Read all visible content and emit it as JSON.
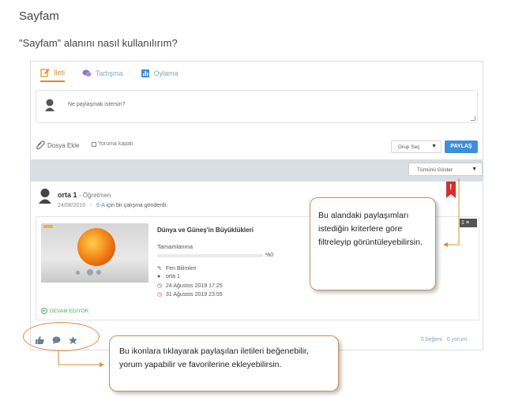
{
  "page": {
    "heading": "Sayfam",
    "question": "\"Sayfam\" alanını nasıl kullanılırım?"
  },
  "composer": {
    "tabs": [
      {
        "label": "İleti",
        "icon": "edit-icon"
      },
      {
        "label": "Tartışma",
        "icon": "chat-icon"
      },
      {
        "label": "Oylama",
        "icon": "poll-icon"
      }
    ],
    "placeholder": "Ne paylaşmak istersin?",
    "attach_label": "Dosya Ekle",
    "comment_off_label": "Yoruma kapalı",
    "group_select": "Grup Seç",
    "share_label": "PAYLAŞ"
  },
  "filter": {
    "selected": "Tümünü Göster"
  },
  "post": {
    "author": "orta 1",
    "role": "- Öğretmen",
    "date": "24/08/2019",
    "class": "6-A",
    "action_text": "için bir çalışma gönderdi.",
    "card": {
      "title": "Dünya ve Güneş'in Büyüklükleri",
      "progress_label": "Tamamlanma",
      "progress_text": "%0",
      "progress_value": 0,
      "subject": "Fen Bilimleri",
      "owner": "orta 1",
      "start": "24 Ağustos 2019 17:25",
      "end": "31 Ağustos 2019 23:55",
      "status": "DEVAM EDİYOR",
      "counter": "1"
    },
    "likes": "0 beğeni",
    "comments": "0 yorum"
  },
  "callouts": {
    "right": "Bu alandaki paylaşımları istediğin kriterlere göre filtreleyip görüntüleyebilirsin.",
    "bottom": "Bu ikonlara tıklayarak paylaşılan iletileri beğenebilir, yorum yapabilir ve favorilerine ekleyebilirsin."
  },
  "colors": {
    "accent": "#e38b23",
    "primary": "#3e8edb",
    "callout_border": "#c69060",
    "flag": "#d32f2f",
    "status_green": "#4caf50"
  }
}
